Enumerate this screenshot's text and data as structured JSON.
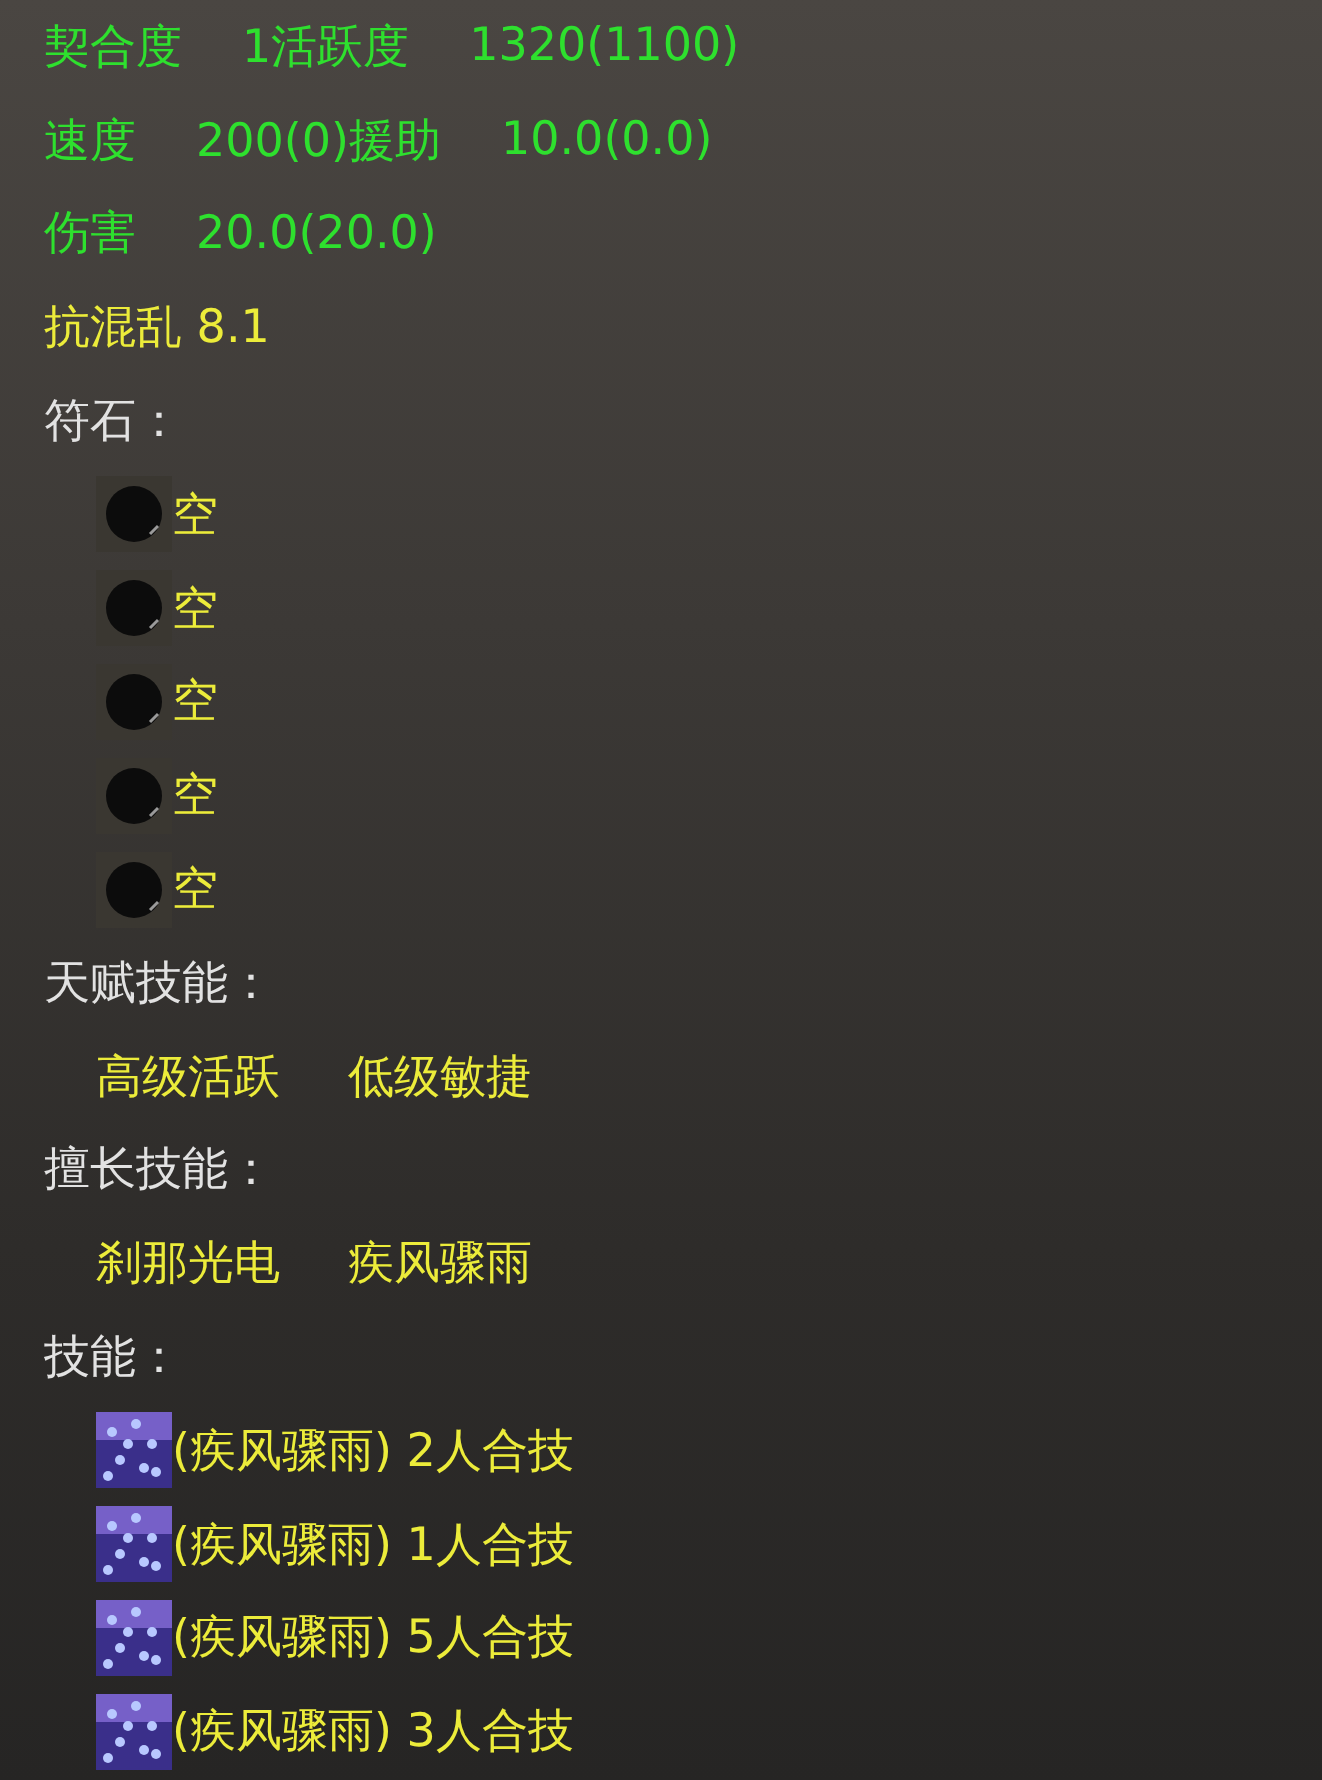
{
  "stats": [
    {
      "kind": "green",
      "parts": [
        "契合度",
        "1活跃度",
        "1320(1100)"
      ]
    },
    {
      "kind": "green",
      "parts": [
        "速度",
        "200(0)援助",
        "10.0(0.0)"
      ]
    },
    {
      "kind": "green",
      "parts": [
        "伤害",
        "20.0(20.0)"
      ]
    },
    {
      "kind": "yellow",
      "parts": [
        "抗混乱 8.1"
      ]
    }
  ],
  "sections": [
    {
      "heading": "符石：",
      "kind": "list",
      "items": [
        {
          "kind": "rune",
          "label": "空"
        },
        {
          "kind": "rune",
          "label": "空"
        },
        {
          "kind": "rune",
          "label": "空"
        },
        {
          "kind": "rune",
          "label": "空"
        },
        {
          "kind": "rune",
          "label": "空"
        }
      ]
    },
    {
      "heading": "天赋技能：",
      "kind": "inline",
      "items": [
        "高级活跃",
        "低级敏捷"
      ]
    },
    {
      "heading": "擅长技能：",
      "kind": "inline",
      "items": [
        "刹那光电",
        "疾风骤雨"
      ]
    },
    {
      "heading": "技能：",
      "kind": "list",
      "items": [
        {
          "kind": "skill",
          "label": "(疾风骤雨) 2人合技"
        },
        {
          "kind": "skill",
          "label": "(疾风骤雨) 1人合技"
        },
        {
          "kind": "skill",
          "label": "(疾风骤雨) 5人合技"
        },
        {
          "kind": "skill",
          "label": "(疾风骤雨) 3人合技"
        }
      ]
    }
  ]
}
